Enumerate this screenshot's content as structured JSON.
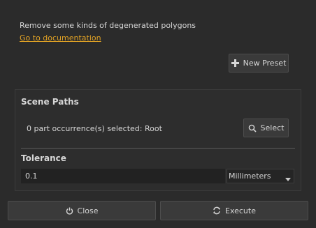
{
  "header": {
    "description": "Remove some kinds of degenerated polygons",
    "doc_link": "Go to documentation"
  },
  "preset": {
    "new_preset_label": "New Preset",
    "icon": "plus-icon"
  },
  "scene_paths": {
    "title": "Scene Paths",
    "selection_text": "0 part occurrence(s) selected: Root",
    "select_label": "Select",
    "select_icon": "magnifier-icon"
  },
  "tolerance": {
    "title": "Tolerance",
    "value": "0.1",
    "unit_selected": "Millimeters"
  },
  "footer": {
    "close_label": "Close",
    "close_icon": "power-icon",
    "execute_label": "Execute",
    "execute_icon": "refresh-icon"
  },
  "colors": {
    "background": "#2b2b2b",
    "link": "#e1a225",
    "button": "#3a3a3a",
    "text": "#d6d6d6"
  }
}
